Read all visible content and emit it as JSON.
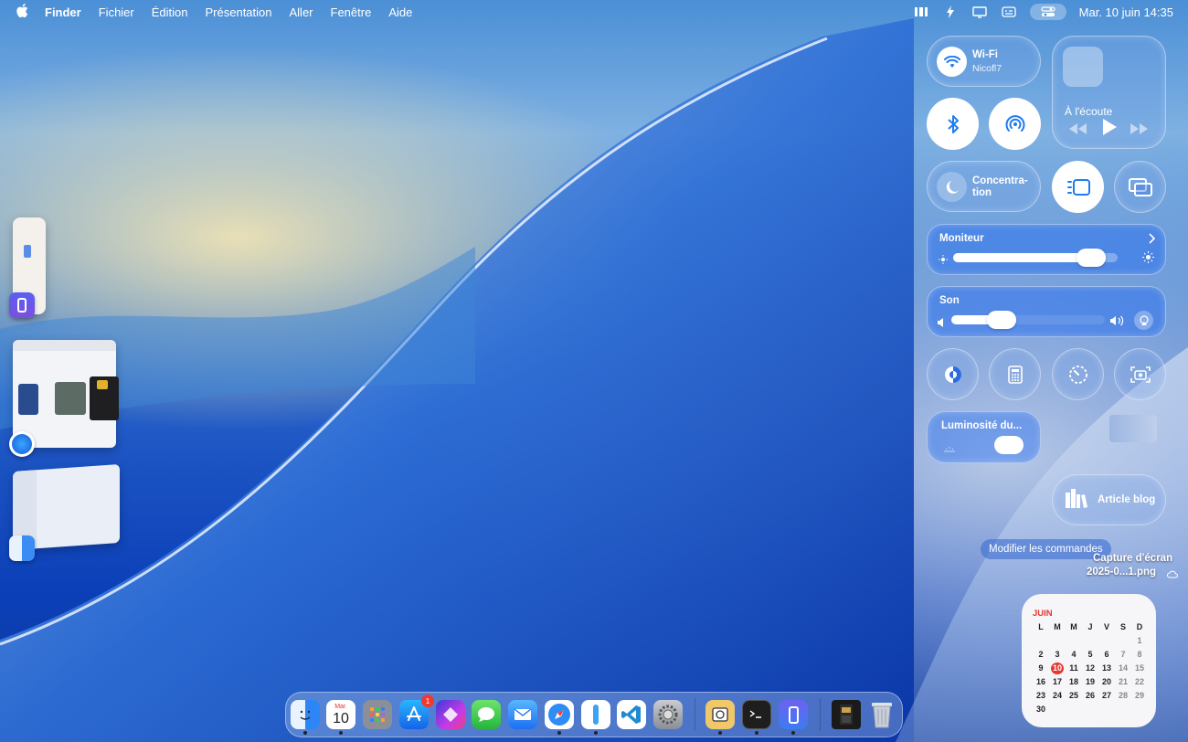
{
  "menubar": {
    "app_name": "Finder",
    "items": [
      "Fichier",
      "Édition",
      "Présentation",
      "Aller",
      "Fenêtre",
      "Aide"
    ],
    "clock": "Mar. 10 juin  14:35"
  },
  "control_center": {
    "wifi": {
      "title": "Wi-Fi",
      "network": "Nicofl7"
    },
    "now_playing": {
      "label": "À l'écoute"
    },
    "focus": {
      "label": "Concentra-\ntion"
    },
    "display": {
      "title": "Moniteur",
      "level": 0.93
    },
    "sound": {
      "title": "Son",
      "level": 0.42
    },
    "keyboard_brightness": {
      "title": "Luminosité du..."
    },
    "shortcut": {
      "label": "Article blog"
    },
    "edit_button": "Modifier les commandes"
  },
  "desktop_file": {
    "line1": "Capture d'écran",
    "line2": "2025-0...1.png"
  },
  "calendar": {
    "month": "JUIN",
    "weekdays": [
      "L",
      "M",
      "M",
      "J",
      "V",
      "S",
      "D"
    ],
    "days": [
      "",
      "",
      "",
      "",
      "",
      "",
      "1",
      "2",
      "3",
      "4",
      "5",
      "6",
      "7",
      "8",
      "9",
      "10",
      "11",
      "12",
      "13",
      "14",
      "15",
      "16",
      "17",
      "18",
      "19",
      "20",
      "21",
      "22",
      "23",
      "24",
      "25",
      "26",
      "27",
      "28",
      "29",
      "30"
    ],
    "today": "10"
  },
  "dock": {
    "calendar_icon_day": "10",
    "calendar_icon_month": "Mar.",
    "app_store_badge": "1"
  },
  "colors": {
    "accent": "#1f7cf0",
    "calendar_today": "#e8352e"
  }
}
